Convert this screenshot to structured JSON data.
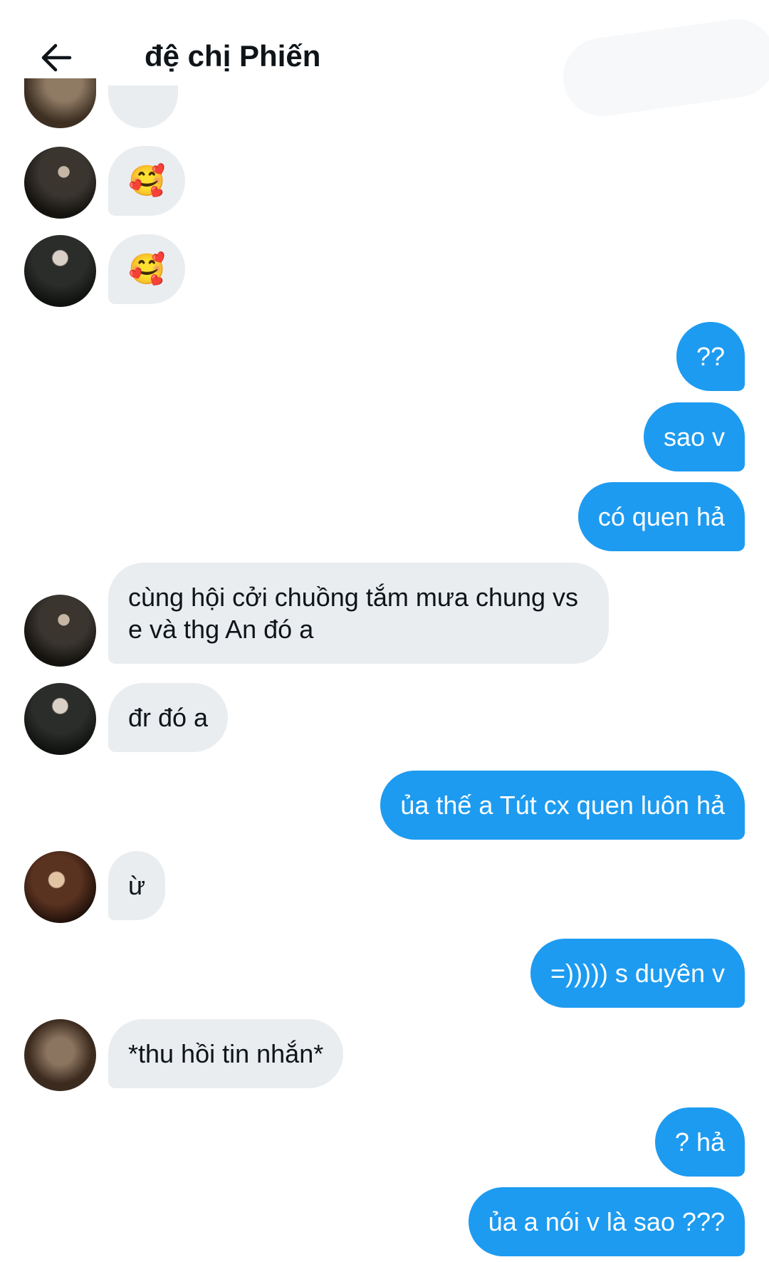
{
  "header": {
    "title": "đệ chị Phiến"
  },
  "messages": [
    {
      "dir": "in",
      "text": "🥰"
    },
    {
      "dir": "in",
      "text": "🥰"
    },
    {
      "dir": "out",
      "text": "??"
    },
    {
      "dir": "out",
      "text": "sao v"
    },
    {
      "dir": "out",
      "text": "có quen hả"
    },
    {
      "dir": "in",
      "text": "cùng hội cởi chuồng tắm mưa chung vs e và thg An đó a"
    },
    {
      "dir": "in",
      "text": "đr đó a"
    },
    {
      "dir": "out",
      "text": "ủa thế a Tút cx quen luôn hả"
    },
    {
      "dir": "in",
      "text": "ừ"
    },
    {
      "dir": "out",
      "text": "=))))) s duyên v"
    },
    {
      "dir": "in",
      "text": "*thu hồi tin nhắn*"
    },
    {
      "dir": "out",
      "text": "? hả"
    },
    {
      "dir": "out",
      "text": "ủa a nói v là sao ???"
    }
  ],
  "colors": {
    "outgoing_bubble": "#1d9bf0",
    "incoming_bubble": "#e9edf0",
    "text": "#0f1419"
  }
}
